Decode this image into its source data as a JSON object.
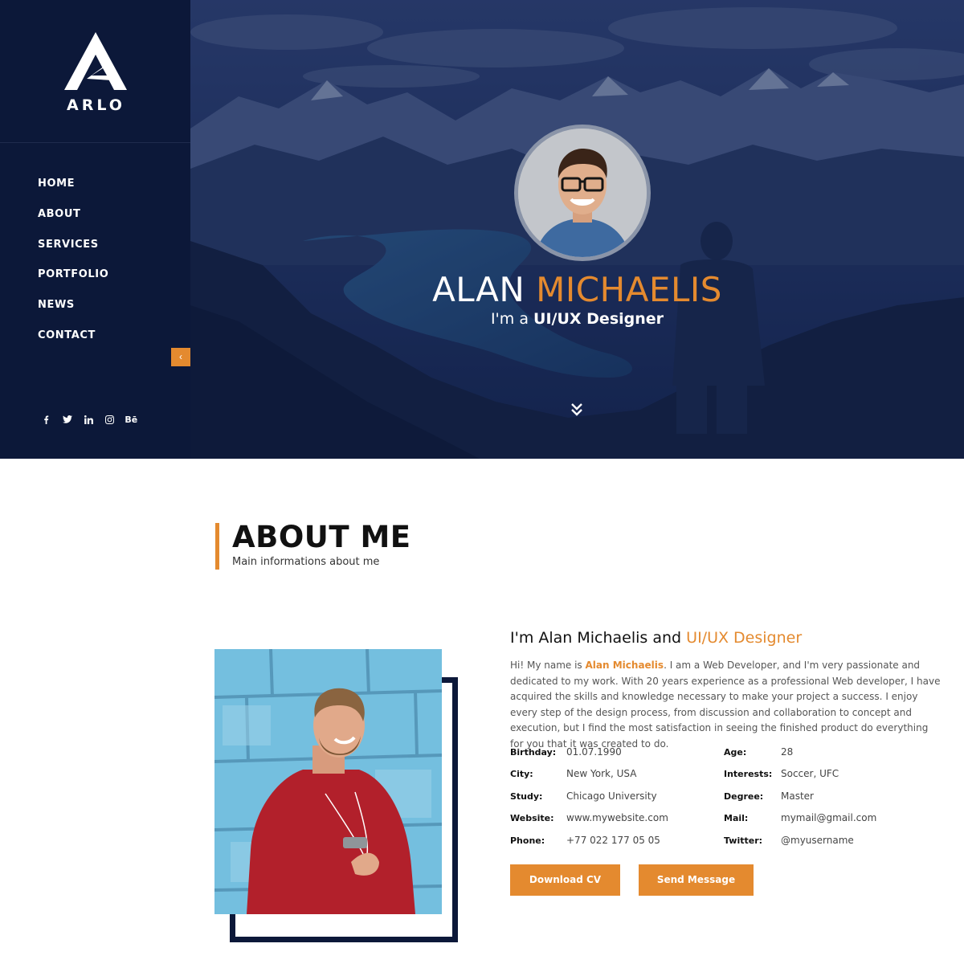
{
  "brand": {
    "name": "ARLO"
  },
  "nav": [
    {
      "label": "HOME"
    },
    {
      "label": "ABOUT"
    },
    {
      "label": "SERVICES"
    },
    {
      "label": "PORTFOLIO"
    },
    {
      "label": "NEWS"
    },
    {
      "label": "CONTACT"
    }
  ],
  "sidebar": {
    "collapse_icon": "chevron-left-icon",
    "collapse_glyph": "‹"
  },
  "socials": [
    {
      "icon": "facebook-icon"
    },
    {
      "icon": "twitter-icon"
    },
    {
      "icon": "linkedin-icon"
    },
    {
      "icon": "instagram-icon"
    },
    {
      "icon": "behance-icon",
      "glyph": "Bē"
    }
  ],
  "hero": {
    "first_name": "ALAN",
    "last_name": "MICHAELIS",
    "tagline_prefix": "I'm a",
    "tagline_role": "UI/UX Designer",
    "scroll_icon": "double-chevron-down-icon"
  },
  "about": {
    "title": "ABOUT ME",
    "subtitle": "Main informations about me",
    "intro_prefix": "I'm Alan Michaelis and",
    "intro_role": "UI/UX Designer",
    "bio_prefix": "Hi! My name is",
    "bio_name": "Alan Michaelis",
    "bio_rest": ". I am a Web Developer, and I'm very passionate and dedicated to my work. With 20 years experience as a professional Web developer, I have acquired the skills and knowledge necessary to make your project a success. I enjoy every step of the design process, from discussion and collaboration to concept and execution, but I find the most satisfaction in seeing the finished product do everything for you that it was created to do.",
    "info_left": [
      {
        "key": "Birthday:",
        "value": "01.07.1990"
      },
      {
        "key": "City:",
        "value": "New York, USA"
      },
      {
        "key": "Study:",
        "value": "Chicago University"
      },
      {
        "key": "Website:",
        "value": "www.mywebsite.com"
      },
      {
        "key": "Phone:",
        "value": "+77 022 177 05 05"
      }
    ],
    "info_right": [
      {
        "key": "Age:",
        "value": "28"
      },
      {
        "key": "Interests:",
        "value": "Soccer, UFC"
      },
      {
        "key": "Degree:",
        "value": "Master"
      },
      {
        "key": "Mail:",
        "value": "mymail@gmail.com"
      },
      {
        "key": "Twitter:",
        "value": "@myusername"
      }
    ],
    "download_cv": "Download CV",
    "send_message": "Send Message"
  },
  "colors": {
    "sidebar_bg": "#0c1839",
    "accent": "#e48a2f",
    "text_dark": "#111111",
    "text_body": "#555555"
  }
}
